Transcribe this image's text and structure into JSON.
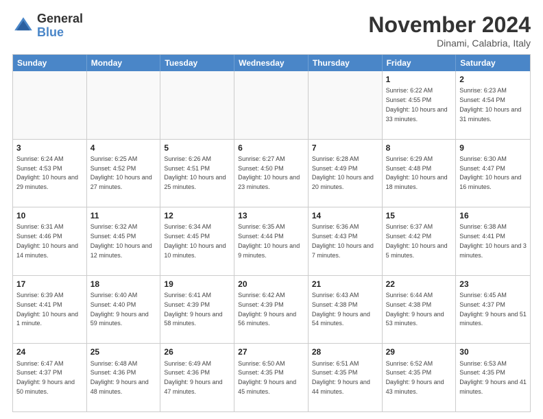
{
  "header": {
    "logo_line1": "General",
    "logo_line2": "Blue",
    "month_title": "November 2024",
    "location": "Dinami, Calabria, Italy"
  },
  "weekdays": [
    "Sunday",
    "Monday",
    "Tuesday",
    "Wednesday",
    "Thursday",
    "Friday",
    "Saturday"
  ],
  "rows": [
    [
      {
        "day": "",
        "info": ""
      },
      {
        "day": "",
        "info": ""
      },
      {
        "day": "",
        "info": ""
      },
      {
        "day": "",
        "info": ""
      },
      {
        "day": "",
        "info": ""
      },
      {
        "day": "1",
        "info": "Sunrise: 6:22 AM\nSunset: 4:55 PM\nDaylight: 10 hours and 33 minutes."
      },
      {
        "day": "2",
        "info": "Sunrise: 6:23 AM\nSunset: 4:54 PM\nDaylight: 10 hours and 31 minutes."
      }
    ],
    [
      {
        "day": "3",
        "info": "Sunrise: 6:24 AM\nSunset: 4:53 PM\nDaylight: 10 hours and 29 minutes."
      },
      {
        "day": "4",
        "info": "Sunrise: 6:25 AM\nSunset: 4:52 PM\nDaylight: 10 hours and 27 minutes."
      },
      {
        "day": "5",
        "info": "Sunrise: 6:26 AM\nSunset: 4:51 PM\nDaylight: 10 hours and 25 minutes."
      },
      {
        "day": "6",
        "info": "Sunrise: 6:27 AM\nSunset: 4:50 PM\nDaylight: 10 hours and 23 minutes."
      },
      {
        "day": "7",
        "info": "Sunrise: 6:28 AM\nSunset: 4:49 PM\nDaylight: 10 hours and 20 minutes."
      },
      {
        "day": "8",
        "info": "Sunrise: 6:29 AM\nSunset: 4:48 PM\nDaylight: 10 hours and 18 minutes."
      },
      {
        "day": "9",
        "info": "Sunrise: 6:30 AM\nSunset: 4:47 PM\nDaylight: 10 hours and 16 minutes."
      }
    ],
    [
      {
        "day": "10",
        "info": "Sunrise: 6:31 AM\nSunset: 4:46 PM\nDaylight: 10 hours and 14 minutes."
      },
      {
        "day": "11",
        "info": "Sunrise: 6:32 AM\nSunset: 4:45 PM\nDaylight: 10 hours and 12 minutes."
      },
      {
        "day": "12",
        "info": "Sunrise: 6:34 AM\nSunset: 4:45 PM\nDaylight: 10 hours and 10 minutes."
      },
      {
        "day": "13",
        "info": "Sunrise: 6:35 AM\nSunset: 4:44 PM\nDaylight: 10 hours and 9 minutes."
      },
      {
        "day": "14",
        "info": "Sunrise: 6:36 AM\nSunset: 4:43 PM\nDaylight: 10 hours and 7 minutes."
      },
      {
        "day": "15",
        "info": "Sunrise: 6:37 AM\nSunset: 4:42 PM\nDaylight: 10 hours and 5 minutes."
      },
      {
        "day": "16",
        "info": "Sunrise: 6:38 AM\nSunset: 4:41 PM\nDaylight: 10 hours and 3 minutes."
      }
    ],
    [
      {
        "day": "17",
        "info": "Sunrise: 6:39 AM\nSunset: 4:41 PM\nDaylight: 10 hours and 1 minute."
      },
      {
        "day": "18",
        "info": "Sunrise: 6:40 AM\nSunset: 4:40 PM\nDaylight: 9 hours and 59 minutes."
      },
      {
        "day": "19",
        "info": "Sunrise: 6:41 AM\nSunset: 4:39 PM\nDaylight: 9 hours and 58 minutes."
      },
      {
        "day": "20",
        "info": "Sunrise: 6:42 AM\nSunset: 4:39 PM\nDaylight: 9 hours and 56 minutes."
      },
      {
        "day": "21",
        "info": "Sunrise: 6:43 AM\nSunset: 4:38 PM\nDaylight: 9 hours and 54 minutes."
      },
      {
        "day": "22",
        "info": "Sunrise: 6:44 AM\nSunset: 4:38 PM\nDaylight: 9 hours and 53 minutes."
      },
      {
        "day": "23",
        "info": "Sunrise: 6:45 AM\nSunset: 4:37 PM\nDaylight: 9 hours and 51 minutes."
      }
    ],
    [
      {
        "day": "24",
        "info": "Sunrise: 6:47 AM\nSunset: 4:37 PM\nDaylight: 9 hours and 50 minutes."
      },
      {
        "day": "25",
        "info": "Sunrise: 6:48 AM\nSunset: 4:36 PM\nDaylight: 9 hours and 48 minutes."
      },
      {
        "day": "26",
        "info": "Sunrise: 6:49 AM\nSunset: 4:36 PM\nDaylight: 9 hours and 47 minutes."
      },
      {
        "day": "27",
        "info": "Sunrise: 6:50 AM\nSunset: 4:35 PM\nDaylight: 9 hours and 45 minutes."
      },
      {
        "day": "28",
        "info": "Sunrise: 6:51 AM\nSunset: 4:35 PM\nDaylight: 9 hours and 44 minutes."
      },
      {
        "day": "29",
        "info": "Sunrise: 6:52 AM\nSunset: 4:35 PM\nDaylight: 9 hours and 43 minutes."
      },
      {
        "day": "30",
        "info": "Sunrise: 6:53 AM\nSunset: 4:35 PM\nDaylight: 9 hours and 41 minutes."
      }
    ]
  ]
}
